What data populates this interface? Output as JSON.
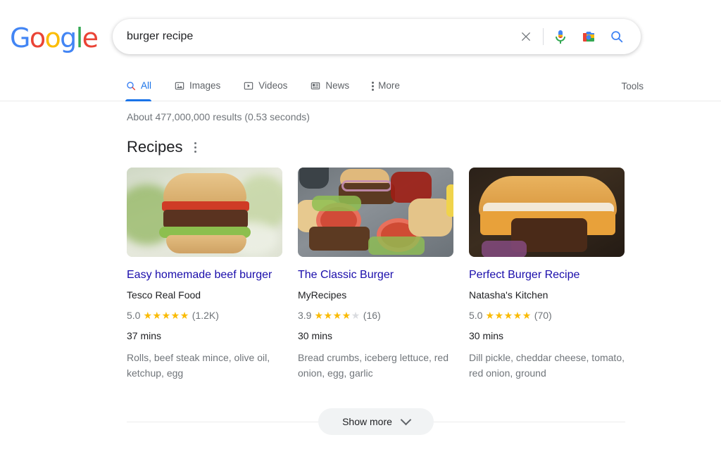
{
  "brand": {
    "name": "Google",
    "letters": [
      {
        "ch": "G",
        "color": "#4285f4"
      },
      {
        "ch": "o",
        "color": "#ea4335"
      },
      {
        "ch": "o",
        "color": "#fbbc05"
      },
      {
        "ch": "g",
        "color": "#4285f4"
      },
      {
        "ch": "l",
        "color": "#34a853"
      },
      {
        "ch": "e",
        "color": "#ea4335"
      }
    ]
  },
  "search": {
    "query": "burger recipe",
    "placeholder": "Search",
    "clear_icon": "close-icon",
    "voice_icon": "microphone-icon",
    "lens_icon": "camera-lens-icon",
    "submit_icon": "search-icon"
  },
  "nav": {
    "tabs": [
      {
        "label": "All",
        "icon": "search-icon",
        "active": true
      },
      {
        "label": "Images",
        "icon": "image-icon",
        "active": false
      },
      {
        "label": "Videos",
        "icon": "video-icon",
        "active": false
      },
      {
        "label": "News",
        "icon": "news-icon",
        "active": false
      },
      {
        "label": "More",
        "icon": "kebab-menu-icon",
        "active": false
      }
    ],
    "tools_label": "Tools"
  },
  "results": {
    "stats": "About 477,000,000 results (0.53 seconds)",
    "section_title": "Recipes",
    "section_menu_icon": "kebab-menu-icon",
    "cards": [
      {
        "title": "Easy homemade beef burger",
        "site": "Tesco Real Food",
        "rating": "5.0",
        "stars_filled": 5,
        "stars_total": 5,
        "reviews": "(1.2K)",
        "time": "37 mins",
        "ingredients": "Rolls, beef steak mince, olive oil, ketchup, egg",
        "image_alt": "beef burger with lettuce and tomato on bright background"
      },
      {
        "title": "The Classic Burger",
        "site": "MyRecipes",
        "rating": "3.9",
        "stars_filled": 4,
        "stars_total": 5,
        "reviews": "(16)",
        "time": "30 mins",
        "ingredients": "Bread crumbs, iceberg lettuce, red onion, egg, garlic",
        "image_alt": "open burgers with tomato and red onion on dark slate"
      },
      {
        "title": "Perfect Burger Recipe",
        "site": "Natasha's Kitchen",
        "rating": "5.0",
        "stars_filled": 5,
        "stars_total": 5,
        "reviews": "(70)",
        "time": "30 mins",
        "ingredients": "Dill pickle, cheddar cheese, tomato, red onion, ground",
        "image_alt": "close-up cheeseburger with melted cheese on dark background"
      }
    ],
    "show_more_label": "Show more",
    "show_more_icon": "chevron-down-icon"
  },
  "colors": {
    "link": "#1a0dab",
    "accent": "#1a73e8",
    "star": "#fabb05",
    "star_empty": "#dadce0",
    "muted_text": "#70757a"
  }
}
